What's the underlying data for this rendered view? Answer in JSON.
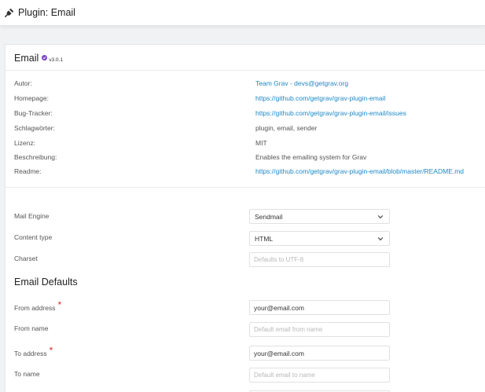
{
  "header": {
    "title": "Plugin: Email"
  },
  "plugin": {
    "name": "Email",
    "version": "v3.0.1"
  },
  "info": [
    {
      "label": "Autor:",
      "value": "Team Grav - devs@getgrav.org",
      "link": true
    },
    {
      "label": "Homepage:",
      "value": "https://github.com/getgrav/grav-plugin-email",
      "link": true
    },
    {
      "label": "Bug-Tracker:",
      "value": "https://github.com/getgrav/grav-plugin-email/issues",
      "link": true
    },
    {
      "label": "Schlagwörter:",
      "value": "plugin, email, sender",
      "link": false
    },
    {
      "label": "Lizenz:",
      "value": "MIT",
      "link": false
    },
    {
      "label": "Beschreibung:",
      "value": "Enables the emailing system for Grav",
      "link": false
    },
    {
      "label": "Readme:",
      "value": "https://github.com/getgrav/grav-plugin-email/blob/master/README.md",
      "link": true
    }
  ],
  "settings": {
    "mail_engine": {
      "label": "Mail Engine",
      "value": "Sendmail"
    },
    "content_type": {
      "label": "Content type",
      "value": "HTML"
    },
    "charset": {
      "label": "Charset",
      "placeholder": "Defaults to UTF-8"
    }
  },
  "defaults": {
    "title": "Email Defaults",
    "from_address": {
      "label": "From address",
      "value": "your@email.com",
      "required_mark": "*"
    },
    "from_name": {
      "label": "From name",
      "placeholder": "Default email from name"
    },
    "to_address": {
      "label": "To address",
      "value": "your@email.com",
      "required_mark": "*"
    },
    "to_name": {
      "label": "To name",
      "placeholder": "Default email to name"
    }
  },
  "colors": {
    "link": "#1e88c5",
    "required": "#e0242a",
    "badge": "#7b46c7"
  }
}
